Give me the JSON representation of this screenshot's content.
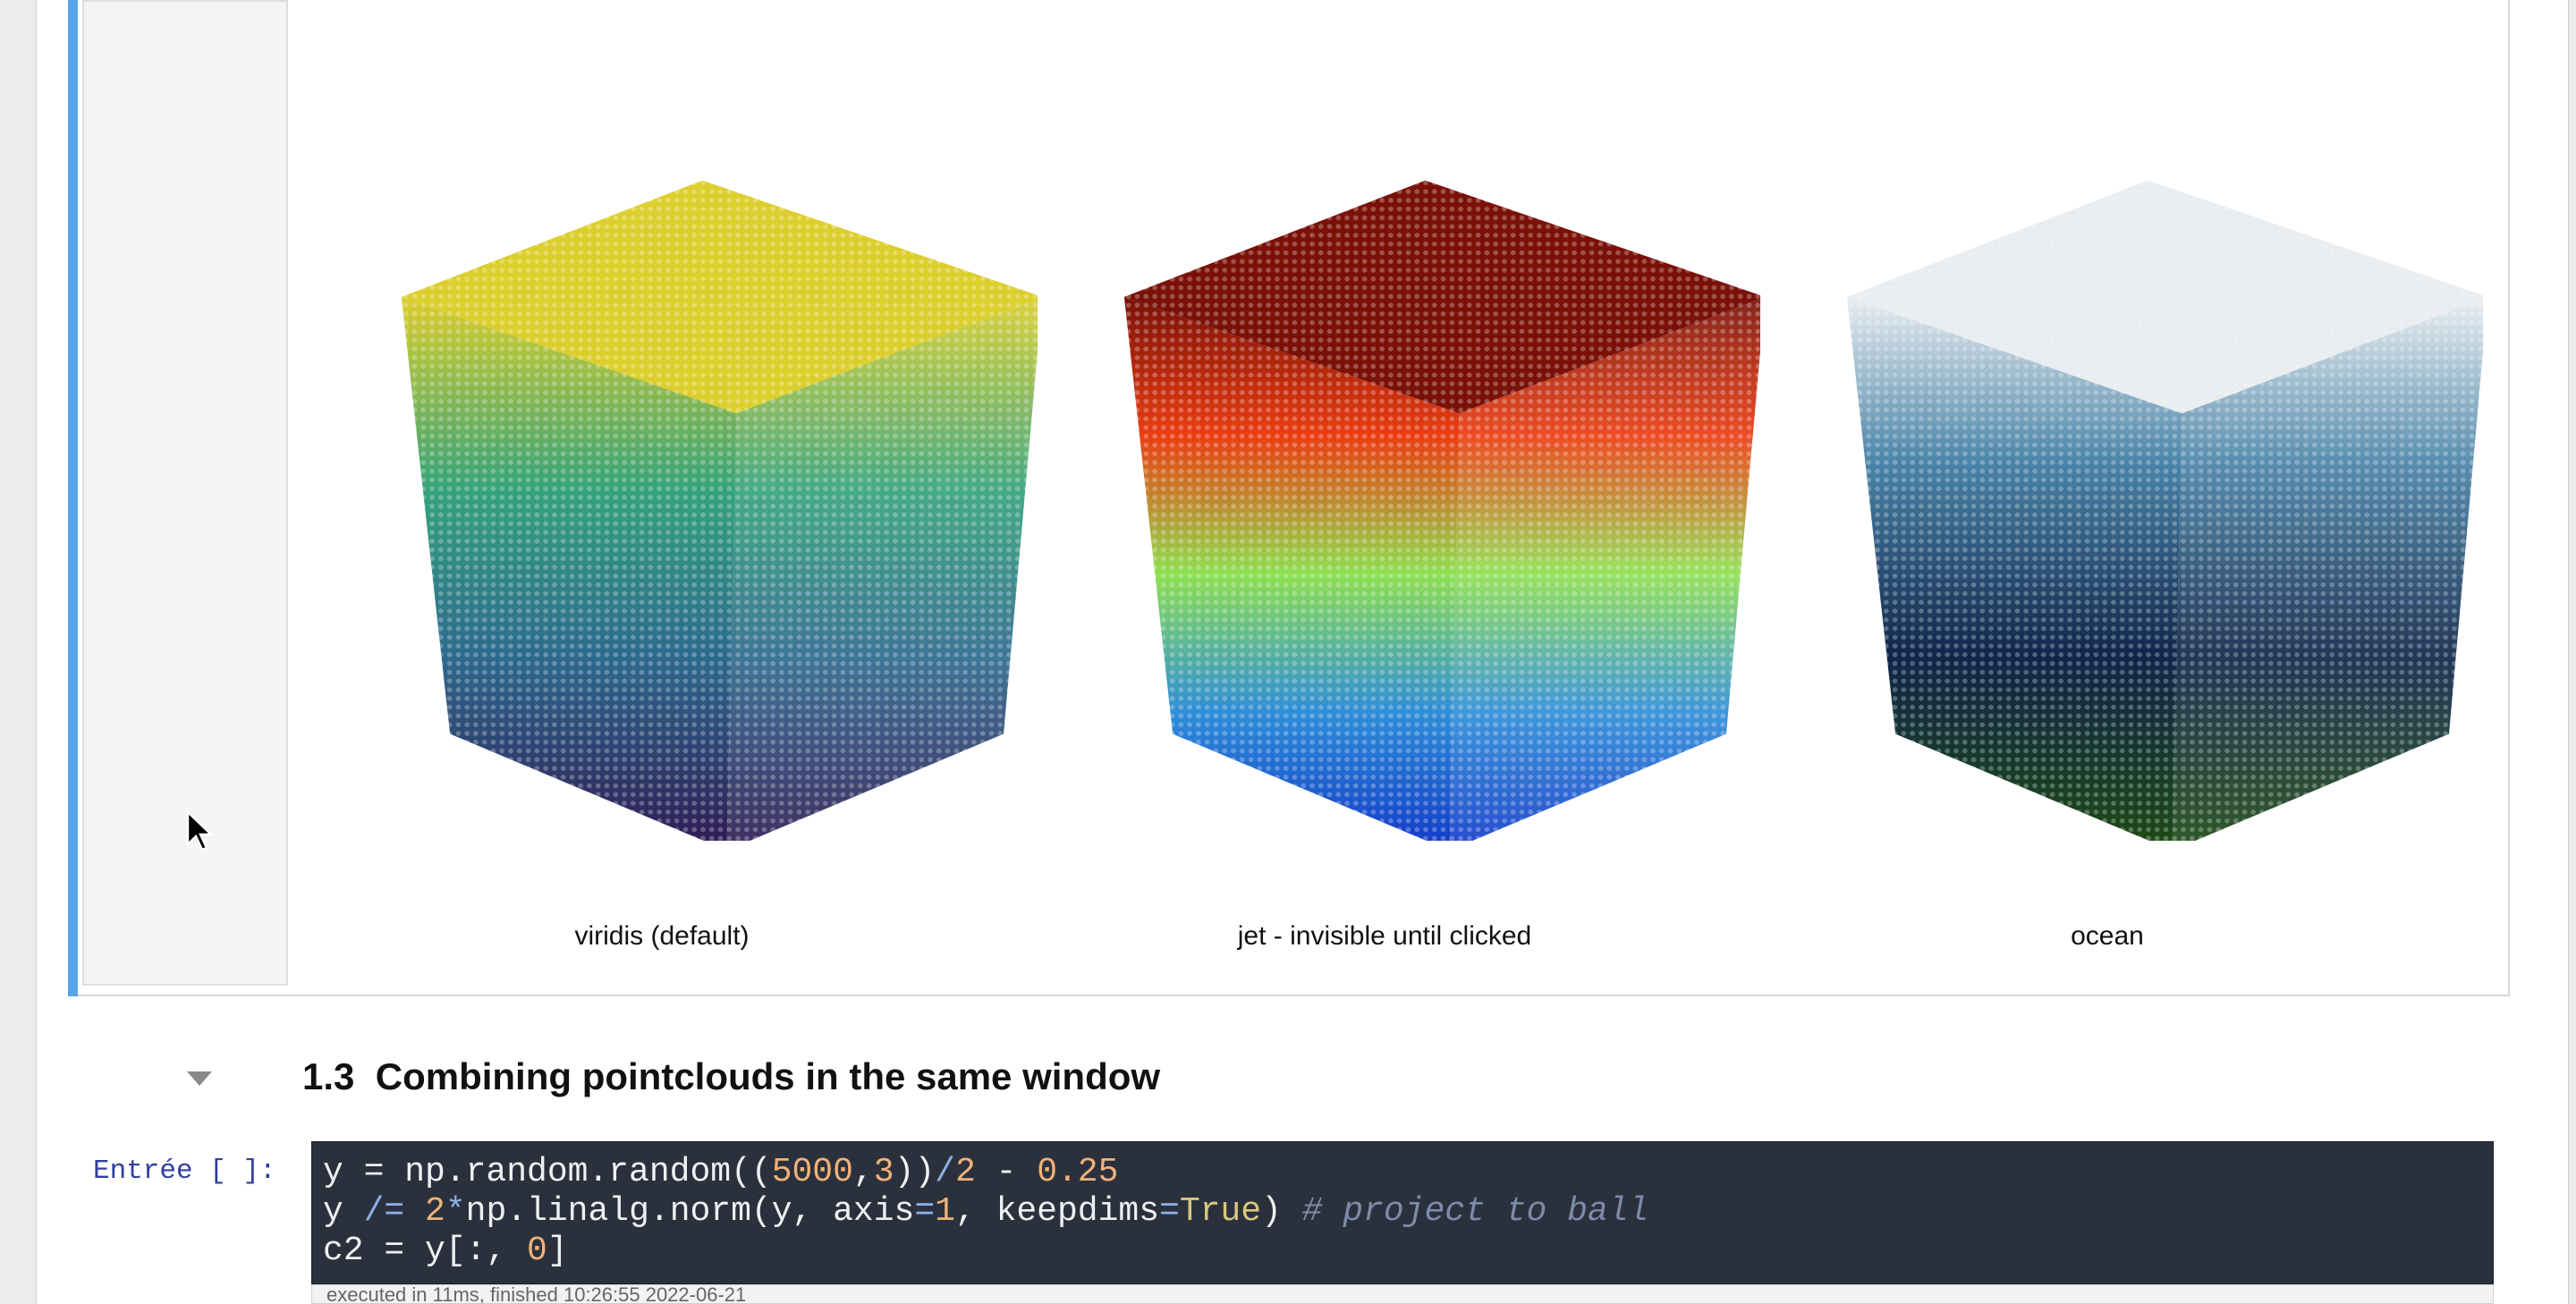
{
  "output_cell": {
    "pointclouds": [
      {
        "label": "viridis (default)",
        "colormap": "viridis",
        "colors": {
          "top": "#dcce2c",
          "mid": "#35a37b",
          "low": "#2e6a8e",
          "bottom": "#2f1a53"
        }
      },
      {
        "label": "jet - invisible until clicked",
        "colormap": "jet",
        "colors": {
          "top": "#7a1108",
          "mid": "#eb3d12",
          "low": "#8fe052",
          "bottom": "#1239c8"
        }
      },
      {
        "label": "ocean",
        "colormap": "ocean",
        "colors": {
          "top": "#e9edf0",
          "mid": "#4a84a8",
          "low": "#10264a",
          "bottom": "#1e4a14"
        }
      }
    ]
  },
  "section": {
    "number": "1.3",
    "title": "Combining pointclouds in the same window",
    "collapse_icon": "caret-down-icon"
  },
  "code_cell": {
    "prompt": "Entrée [ ]:",
    "line1": {
      "a": "y = np.random.random((",
      "n1": "5000",
      "b": ",",
      "n2": "3",
      "c": "))",
      "op1": "/",
      "n3": "2",
      "op2": " - ",
      "n4": "0.25"
    },
    "line2": {
      "a": "y ",
      "op1": "/=",
      "b": " ",
      "n1": "2",
      "op2": "*",
      "c": "np.linalg.norm(y, axis",
      "op3": "=",
      "n2": "1",
      "d": ", keepdims",
      "op4": "=",
      "kw": "True",
      "e": ") ",
      "comment": "# project to ball"
    },
    "line3": {
      "a": "c2 = y[:, ",
      "n1": "0",
      "b": "]"
    },
    "exec_info": "executed in 11ms, finished 10:26:55 2022-06-21"
  },
  "colors": {
    "cell_indicator": "#58a4e6",
    "code_background": "#2b313c",
    "prompt": "#303f9f"
  }
}
